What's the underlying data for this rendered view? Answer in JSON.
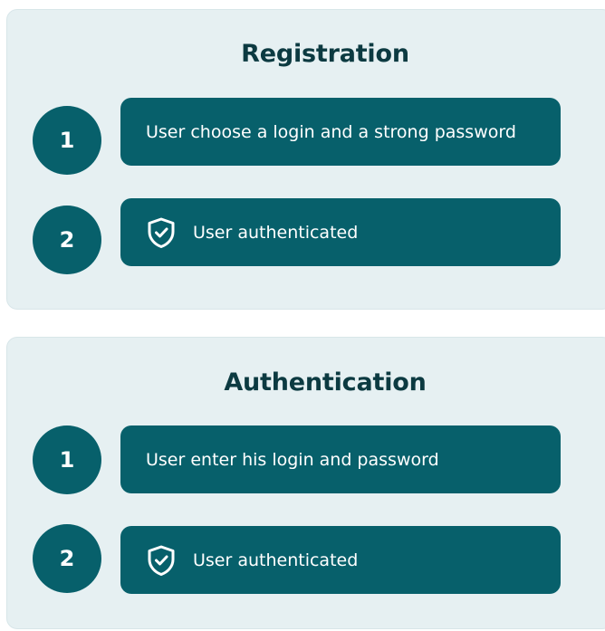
{
  "sections": [
    {
      "title": "Registration",
      "steps": [
        {
          "number": "1",
          "text": "User choose a login and a strong password",
          "icon": null
        },
        {
          "number": "2",
          "text": "User authenticated",
          "icon": "shield-check-icon"
        }
      ]
    },
    {
      "title": "Authentication",
      "steps": [
        {
          "number": "1",
          "text": "User enter his login and password",
          "icon": null
        },
        {
          "number": "2",
          "text": "User authenticated",
          "icon": "shield-check-icon"
        }
      ]
    }
  ],
  "colors": {
    "panel_background": "#e6f0f2",
    "title_text": "#0c3a41",
    "step_fill": "#07606b",
    "step_text": "#ffffff"
  }
}
